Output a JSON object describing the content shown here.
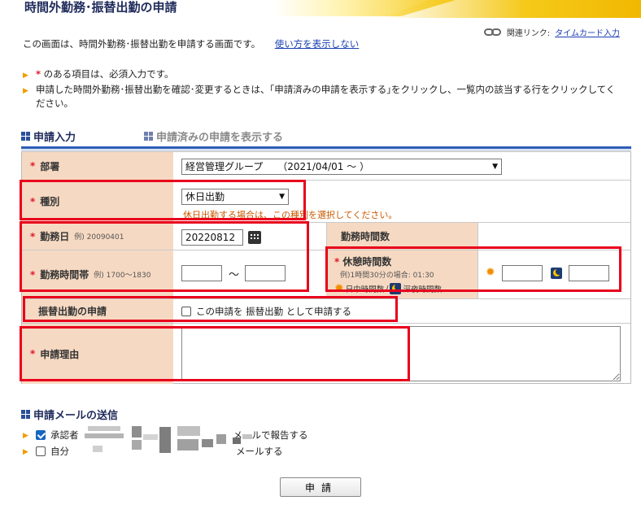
{
  "page": {
    "title": "時間外勤務･振替出勤の申請",
    "related_label": "関連リンク:",
    "related_link": "タイムカード入力",
    "intro_text": "この画面は、時間外勤務･振替出勤を申請する画面です。",
    "intro_link": "使い方を表示しない",
    "bullet1_suffix": " のある項目は、必須入力です。",
    "bullet2": "申請した時間外勤務･振替出勤を確認･変更するときは、｢申請済みの申請を表示する｣をクリックし、一覧内の該当する行をクリックしてください。"
  },
  "tabs": {
    "active": "申請入力",
    "inactive": "申請済みの申請を表示する"
  },
  "form": {
    "required_mark": "*",
    "dept": {
      "label": "部署",
      "value": "経営管理グループ　　（2021/04/01 ～ ）"
    },
    "kind": {
      "label": "種別",
      "value": "休日出勤",
      "note": "休日出勤する場合は、この種別を選択してください。"
    },
    "workday": {
      "label": "勤務日",
      "example": "例) 20090401",
      "value": "20220812"
    },
    "worktime": {
      "label": "勤務時間帯",
      "example": "例) 1700～1830",
      "separator": "～",
      "from": "",
      "to": ""
    },
    "hours": {
      "label": "勤務時間数"
    },
    "break": {
      "label": "休憩時間数",
      "example": "例)1時間30分の場合: 01:30",
      "day_label": "日中時間数",
      "slash": "/",
      "night_label": "深夜時間数",
      "day_value": "",
      "night_value": ""
    },
    "substitute": {
      "label": "振替出勤の申請",
      "check_text": "この申請を 振替出勤 として申請する",
      "checked": false
    },
    "reason": {
      "label": "申請理由",
      "value": ""
    }
  },
  "mail": {
    "title": "申請メールの送信",
    "approver_prefix": "承認者",
    "approver_suffix": "メールで報告する",
    "approver_checked": true,
    "self_prefix": "自分",
    "self_suffix": "メールする",
    "self_checked": false
  },
  "submit_label": "申請"
}
